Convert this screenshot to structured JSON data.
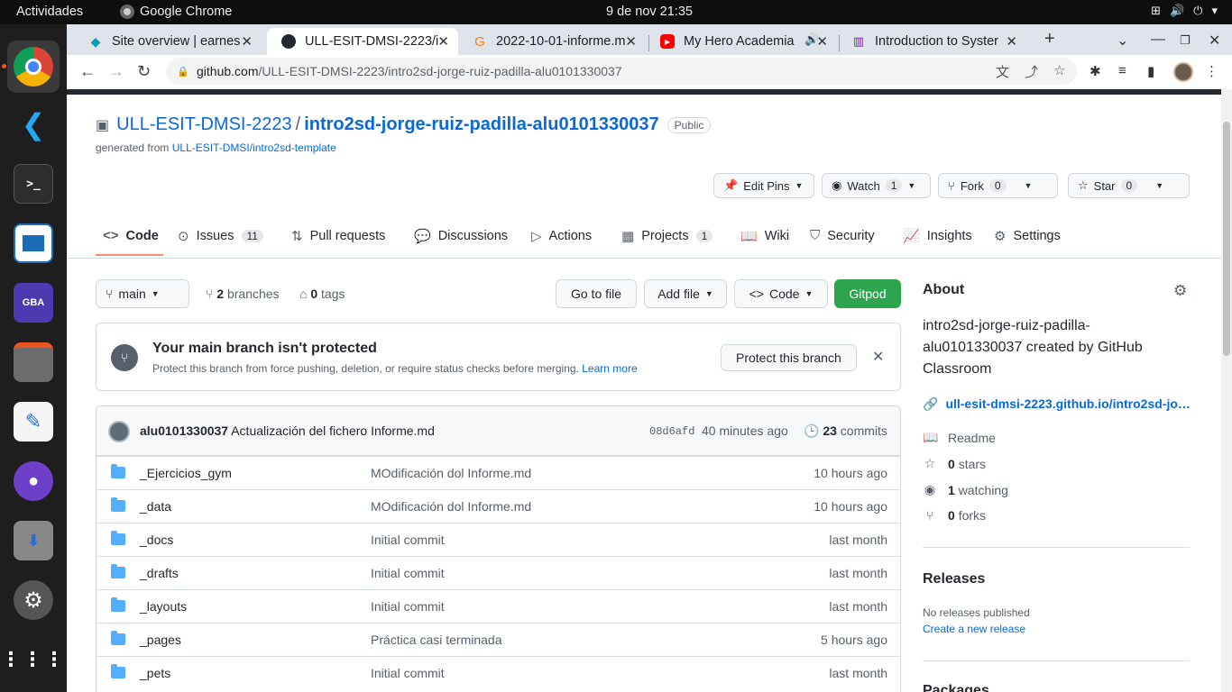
{
  "system": {
    "activities": "Actividades",
    "app_name": "Google Chrome",
    "clock": "9 de nov  21:35"
  },
  "chrome": {
    "tabs": [
      {
        "title": "Site overview | earnes"
      },
      {
        "title": "ULL-ESIT-DMSI-2223/i"
      },
      {
        "title": "2022-10-01-informe.m"
      },
      {
        "title": "My Hero Academia"
      },
      {
        "title": "Introduction to Syster"
      }
    ],
    "url_host": "github.com",
    "url_path": "/ULL-ESIT-DMSI-2223/intro2sd-jorge-ruiz-padilla-alu0101330037"
  },
  "repo": {
    "owner": "ULL-ESIT-DMSI-2223",
    "separator": "/",
    "name": "intro2sd-jorge-ruiz-padilla-alu0101330037",
    "visibility": "Public",
    "generated_prefix": "generated from",
    "template": "ULL-ESIT-DMSI/intro2sd-template"
  },
  "actions": {
    "edit_pins": "Edit Pins",
    "watch": "Watch",
    "watch_count": "1",
    "fork": "Fork",
    "fork_count": "0",
    "star": "Star",
    "star_count": "0"
  },
  "nav": {
    "code": "Code",
    "issues": "Issues",
    "issues_count": "11",
    "pull_requests": "Pull requests",
    "discussions": "Discussions",
    "actions": "Actions",
    "projects": "Projects",
    "projects_count": "1",
    "wiki": "Wiki",
    "security": "Security",
    "insights": "Insights",
    "settings": "Settings"
  },
  "toolbar": {
    "branch": "main",
    "branches_count": "2",
    "branches_label": "branches",
    "tags_count": "0",
    "tags_label": "tags",
    "go_to_file": "Go to file",
    "add_file": "Add file",
    "code": "Code",
    "gitpod": "Gitpod"
  },
  "protect": {
    "title": "Your main branch isn't protected",
    "description": "Protect this branch from force pushing, deletion, or require status checks before merging.",
    "learn_more": "Learn more",
    "button": "Protect this branch"
  },
  "commit": {
    "author": "alu0101330037",
    "message": "Actualización del fichero Informe.md",
    "sha": "08d6afd",
    "time": "40 minutes ago",
    "count": "23",
    "count_label": "commits"
  },
  "files": [
    {
      "name": "_Ejercicios_gym",
      "message": "MOdificación dol Informe.md",
      "age": "10 hours ago"
    },
    {
      "name": "_data",
      "message": "MOdificación dol Informe.md",
      "age": "10 hours ago"
    },
    {
      "name": "_docs",
      "message": "Initial commit",
      "age": "last month"
    },
    {
      "name": "_drafts",
      "message": "Initial commit",
      "age": "last month"
    },
    {
      "name": "_layouts",
      "message": "Initial commit",
      "age": "last month"
    },
    {
      "name": "_pages",
      "message": "Práctica casi terminada",
      "age": "5 hours ago"
    },
    {
      "name": "_pets",
      "message": "Initial commit",
      "age": "last month"
    }
  ],
  "about": {
    "title": "About",
    "description": "intro2sd-jorge-ruiz-padilla-alu0101330037 created by GitHub Classroom",
    "link": "ull-esit-dmsi-2223.github.io/intro2sd-jo…",
    "readme": "Readme",
    "stars_count": "0",
    "stars_label": "stars",
    "watching_count": "1",
    "watching_label": "watching",
    "forks_count": "0",
    "forks_label": "forks"
  },
  "releases": {
    "title": "Releases",
    "none": "No releases published",
    "create": "Create a new release"
  },
  "packages": {
    "title": "Packages"
  }
}
